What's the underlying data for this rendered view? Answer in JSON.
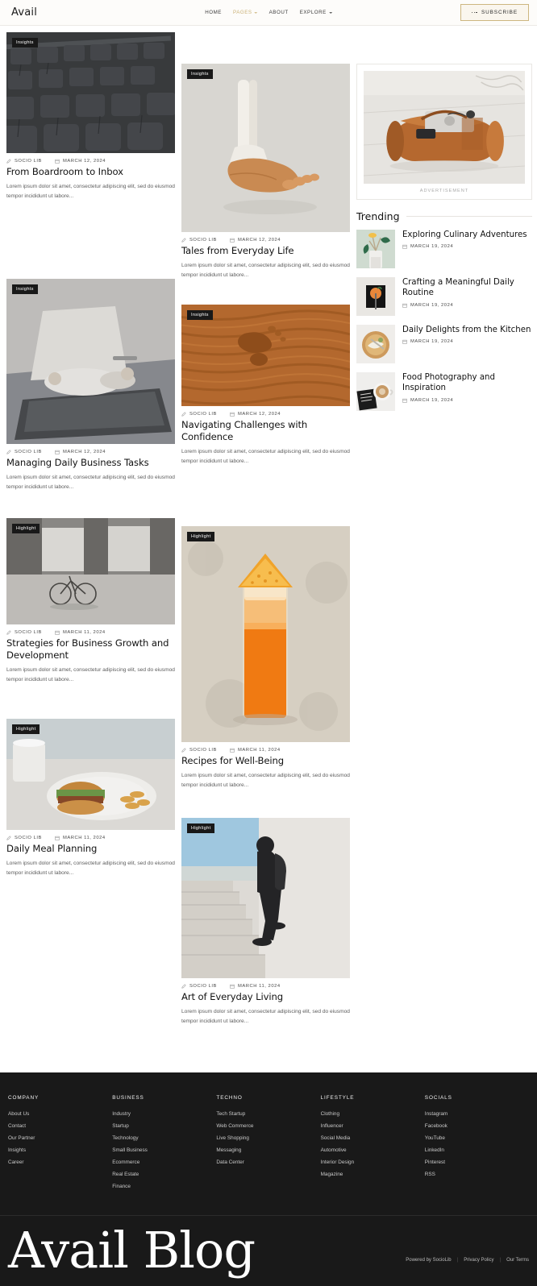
{
  "header": {
    "brand": "Avail",
    "nav": [
      {
        "label": "HOME",
        "active": false,
        "caret": false
      },
      {
        "label": "PAGES",
        "active": true,
        "caret": true
      },
      {
        "label": "ABOUT",
        "active": false,
        "caret": false
      },
      {
        "label": "EXPLORE",
        "active": false,
        "caret": true
      }
    ],
    "subscribe_label": "SUBSCRIBE",
    "accent_color": "#cbb277"
  },
  "posts": {
    "col1": [
      {
        "badge": "Insights",
        "author": "SOCIO LIB",
        "date": "MARCH 12, 2024",
        "title": "From Boardroom to Inbox",
        "excerpt": "Lorem ipsum dolor sit amet, consectetur adipiscing elit, sed do eiusmod tempor incididunt ut labore...",
        "image": "rows-of-chairs"
      },
      {
        "badge": "Insights",
        "author": "SOCIO LIB",
        "date": "MARCH 12, 2024",
        "title": "Managing Daily Business Tasks",
        "excerpt": "Lorem ipsum dolor sit amet, consectetur adipiscing elit, sed do eiusmod tempor incididunt ut labore...",
        "image": "hands-on-laptop"
      },
      {
        "badge": "Highlight",
        "author": "SOCIO LIB",
        "date": "MARCH 11, 2024",
        "title": "Strategies for Business Growth and Development",
        "excerpt": "Lorem ipsum dolor sit amet, consectetur adipiscing elit, sed do eiusmod tempor incididunt ut labore...",
        "image": "bicycle-concrete"
      },
      {
        "badge": "Highlight",
        "author": "SOCIO LIB",
        "date": "MARCH 11, 2024",
        "title": "Daily Meal Planning",
        "excerpt": "Lorem ipsum dolor sit amet, consectetur adipiscing elit, sed do eiusmod tempor incididunt ut labore...",
        "image": "burger-plate"
      }
    ],
    "col2": [
      {
        "badge": "Insights",
        "author": "SOCIO LIB",
        "date": "MARCH 12, 2024",
        "title": "Tales from Everyday Life",
        "excerpt": "Lorem ipsum dolor sit amet, consectetur adipiscing elit, sed do eiusmod tempor incididunt ut labore...",
        "image": "foot-skeleton"
      },
      {
        "badge": "Insights",
        "author": "SOCIO LIB",
        "date": "MARCH 12, 2024",
        "title": "Navigating Challenges with Confidence",
        "excerpt": "Lorem ipsum dolor sit amet, consectetur adipiscing elit, sed do eiusmod tempor incididunt ut labore...",
        "image": "footprint-sand"
      },
      {
        "badge": "Highlight",
        "author": "SOCIO LIB",
        "date": "MARCH 11, 2024",
        "title": "Recipes for Well-Being",
        "excerpt": "Lorem ipsum dolor sit amet, consectetur adipiscing elit, sed do eiusmod tempor incididunt ut labore...",
        "image": "orange-drink"
      },
      {
        "badge": "Highlight",
        "author": "SOCIO LIB",
        "date": "MARCH 11, 2024",
        "title": "Art of Everyday Living",
        "excerpt": "Lorem ipsum dolor sit amet, consectetur adipiscing elit, sed do eiusmod tempor incididunt ut labore...",
        "image": "person-stairs"
      }
    ]
  },
  "sidebar": {
    "ad_label": "ADVERTISEMENT",
    "ad_image": "leather-duffel-bag",
    "trending_title": "Trending",
    "trending": [
      {
        "title": "Exploring Culinary Adventures",
        "date": "MARCH 19, 2024",
        "image": "flower-glass"
      },
      {
        "title": "Crafting a Meaningful Daily Routine",
        "date": "MARCH 19, 2024",
        "image": "orange-on-black"
      },
      {
        "title": "Daily Delights from the Kitchen",
        "date": "MARCH 19, 2024",
        "image": "cheese-board"
      },
      {
        "title": "Food Photography and Inspiration",
        "date": "MARCH 19, 2024",
        "image": "latte-book"
      }
    ]
  },
  "footer": {
    "columns": [
      {
        "heading": "COMPANY",
        "links": [
          "About Us",
          "Contact",
          "Our Partner",
          "Insights",
          "Career"
        ]
      },
      {
        "heading": "BUSINESS",
        "links": [
          "Industry",
          "Startup",
          "Technology",
          "Small Business",
          "Ecommerce",
          "Real Estate",
          "Finance"
        ]
      },
      {
        "heading": "TECHNO",
        "links": [
          "Tech Startup",
          "Web Commerce",
          "Live Shopping",
          "Messaging",
          "Data Center"
        ]
      },
      {
        "heading": "LIFESTYLE",
        "links": [
          "Clothing",
          "Influencer",
          "Social Media",
          "Automotive",
          "Interior Design",
          "Magazine"
        ]
      },
      {
        "heading": "SOCIALS",
        "links": [
          "Instagram",
          "Facebook",
          "YouTube",
          "LinkedIn",
          "Pinterest",
          "RSS"
        ]
      }
    ],
    "big_brand": "Avail Blog",
    "legal": {
      "powered_by": "Powered by SocioLib",
      "privacy": "Privacy Policy",
      "terms": "Our Terms"
    }
  }
}
